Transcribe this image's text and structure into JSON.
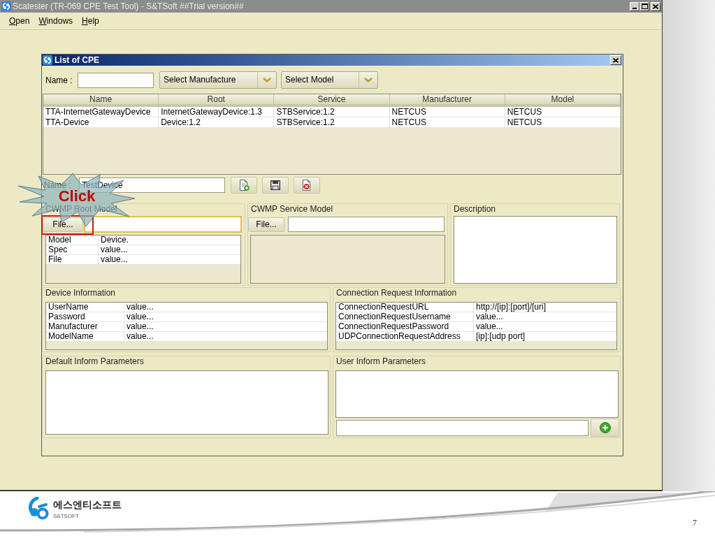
{
  "app_window": {
    "title": "Scatester (TR-069 CPE Test Tool) - S&TSoft ##Trial version##",
    "menu": [
      {
        "label": "Open"
      },
      {
        "label": "Windows"
      },
      {
        "label": "Help"
      }
    ]
  },
  "dialog": {
    "title": "List of CPE",
    "filter": {
      "name_label": "Name :",
      "manufacture_select": "Select Manufacture",
      "model_select": "Select Model"
    },
    "cpe_table": {
      "columns": [
        "Name",
        "Root",
        "Service",
        "Manufacturer",
        "Model"
      ],
      "rows": [
        {
          "cells": [
            "TTA-InternetGatewayDevice",
            "InternetGatewayDevice:1.3",
            "STBService:1.2",
            "NETCUS",
            "NETCUS"
          ],
          "selected": false
        },
        {
          "cells": [
            "TTA-Device",
            "Device:1.2",
            "STBService:1.2",
            "NETCUS",
            "NETCUS"
          ],
          "selected": false
        }
      ]
    },
    "editor": {
      "name_label": "Name :",
      "name_value": "TestDevice"
    },
    "cwmp_root_model": {
      "label": "CWMP Root Model",
      "file_button": {
        "label": "File...",
        "highlighted": true
      },
      "file_field": {
        "focused": true
      },
      "properties": [
        {
          "key": "Model",
          "value": "Device."
        },
        {
          "key": "Spec",
          "value": "value..."
        },
        {
          "key": "File",
          "value": "value..."
        }
      ]
    },
    "cwmp_service_model": {
      "label": "CWMP Service Model",
      "file_button": {
        "label": "File...",
        "highlighted": false
      },
      "file_field": {
        "focused": false
      }
    },
    "description": {
      "label": "Description"
    },
    "device_information": {
      "label": "Device Information",
      "properties": [
        {
          "key": "UserName",
          "value": "value..."
        },
        {
          "key": "Password",
          "value": "value..."
        },
        {
          "key": "Manufacturer",
          "value": "value..."
        },
        {
          "key": "ModelName",
          "value": "value..."
        }
      ]
    },
    "connection_request_information": {
      "label": "Connection Request Information",
      "properties": [
        {
          "key": "ConnectionRequestURL",
          "value": "http://[ip]:[port]/[uri]"
        },
        {
          "key": "ConnectionRequestUsername",
          "value": "value..."
        },
        {
          "key": "ConnectionRequestPassword",
          "value": "value..."
        },
        {
          "key": "UDPConnectionRequestAddress",
          "value": "[ip]:[udp port]"
        }
      ]
    },
    "default_inform_parameters": {
      "label": "Default Inform Parameters"
    },
    "user_inform_parameters": {
      "label": "User Inform Parameters"
    }
  },
  "callout": {
    "text": "Click"
  },
  "footer": {
    "logo_text": "에스엔티소프트",
    "logo_subtext": "S&TSOFT",
    "page_number": "7"
  }
}
